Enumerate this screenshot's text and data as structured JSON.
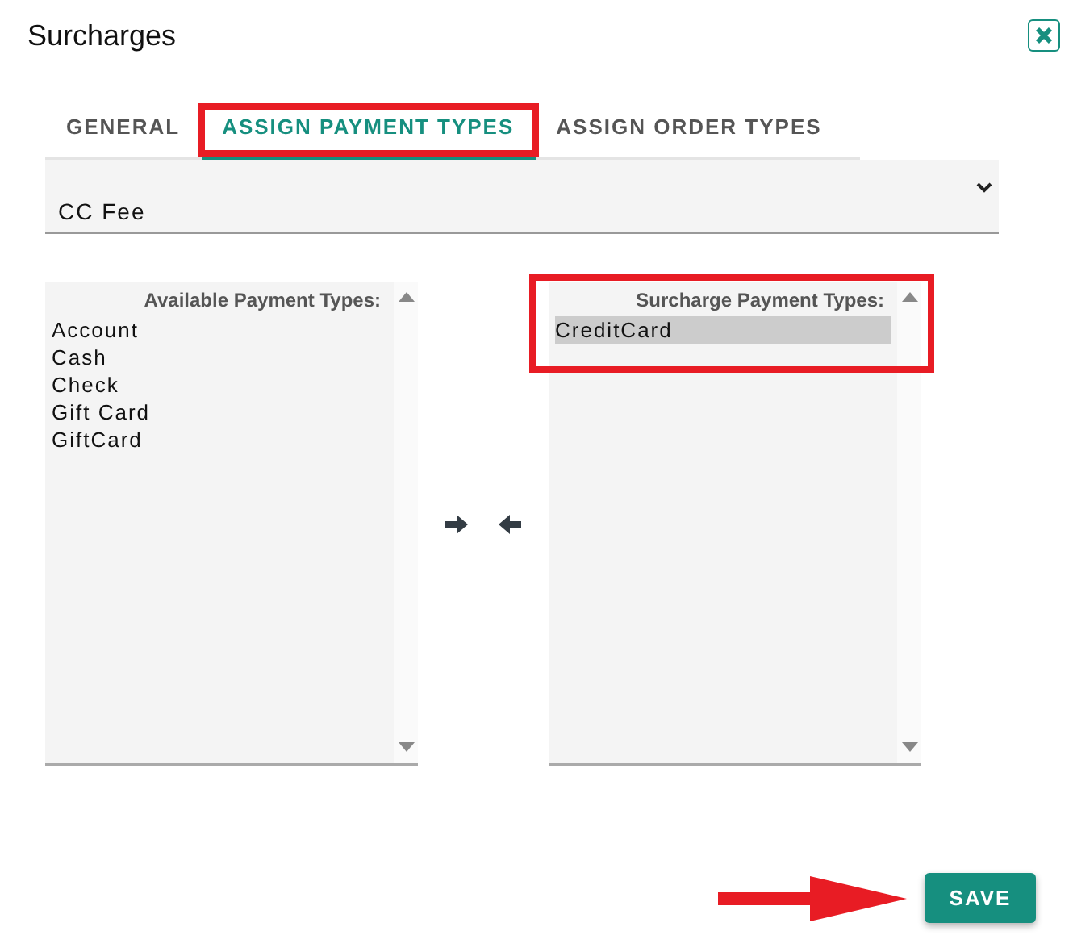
{
  "window": {
    "title": "Surcharges"
  },
  "tabs": [
    {
      "label": "GENERAL",
      "selected": false,
      "highlighted": false
    },
    {
      "label": "ASSIGN PAYMENT TYPES",
      "selected": true,
      "highlighted": true
    },
    {
      "label": "ASSIGN ORDER TYPES",
      "selected": false,
      "highlighted": false
    }
  ],
  "surcharge_select": {
    "value": "CC Fee"
  },
  "lists": [
    {
      "title": "Available Payment Types:",
      "highlighted": false,
      "items": [
        {
          "label": "Account",
          "selected": false
        },
        {
          "label": "Cash",
          "selected": false
        },
        {
          "label": "Check",
          "selected": false
        },
        {
          "label": "Gift Card",
          "selected": false
        },
        {
          "label": "GiftCard",
          "selected": false
        }
      ]
    },
    {
      "title": "Surcharge Payment Types:",
      "highlighted": true,
      "items": [
        {
          "label": "CreditCard",
          "selected": true
        }
      ]
    }
  ],
  "save_button": {
    "label": "SAVE",
    "pointer_arrow": true
  }
}
